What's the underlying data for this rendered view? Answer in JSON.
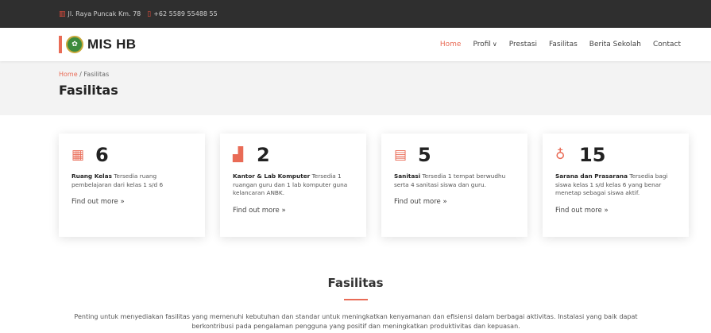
{
  "topbar": {
    "address_icon": "map-icon",
    "address": "Jl. Raya Puncak Km. 78",
    "phone_icon": "phone-icon",
    "phone": "+62 5589 55488 55"
  },
  "navbar": {
    "brand": "MIS HB",
    "menu": [
      "Home",
      "Profil",
      "Prestasi",
      "Fasilitas",
      "Berita Sekolah",
      "Contact"
    ]
  },
  "pagehead": {
    "crumb_home": "Home",
    "crumb_sep": "/",
    "crumb_current": "Fasilitas",
    "title": "Fasilitas"
  },
  "cards": [
    {
      "icon": "building-icon",
      "number": "6",
      "title": "Ruang Kelas",
      "text": " Tersedia ruang pembelajaran dari kelas 1 s/d 6",
      "link": "Find out more »"
    },
    {
      "icon": "office-icon",
      "number": "2",
      "title": "Kantor & Lab Komputer",
      "text": " Tersedia 1 ruangan guru dan 1 lab komputer guna kelancaran ANBK.",
      "link": "Find out more »"
    },
    {
      "icon": "receipt-icon",
      "number": "5",
      "title": "Sanitasi",
      "text": " Tersedia 1 tempat berwudhu serta 4 sanitasi siswa dan guru.",
      "link": "Find out more »"
    },
    {
      "icon": "people-icon",
      "number": "15",
      "title": "Sarana dan Prasarana",
      "text": " Tersedia bagi siswa kelas 1 s/d kelas 6 yang benar menetap sebagai siswa aktif.",
      "link": "Find out more »"
    }
  ],
  "about": {
    "title": "Fasilitas",
    "text": "Penting untuk menyediakan fasilitas yang memenuhi kebutuhan dan standar untuk meningkatkan kenyamanan dan efisiensi dalam berbagai aktivitas. Instalasi yang baik dapat berkontribusi pada pengalaman pengguna yang positif dan meningkatkan produktivitas dan kepuasan."
  },
  "colors": {
    "accent": "#e96b56",
    "topbar": "#2f2f2f",
    "pagehead": "#f3f3f3"
  }
}
